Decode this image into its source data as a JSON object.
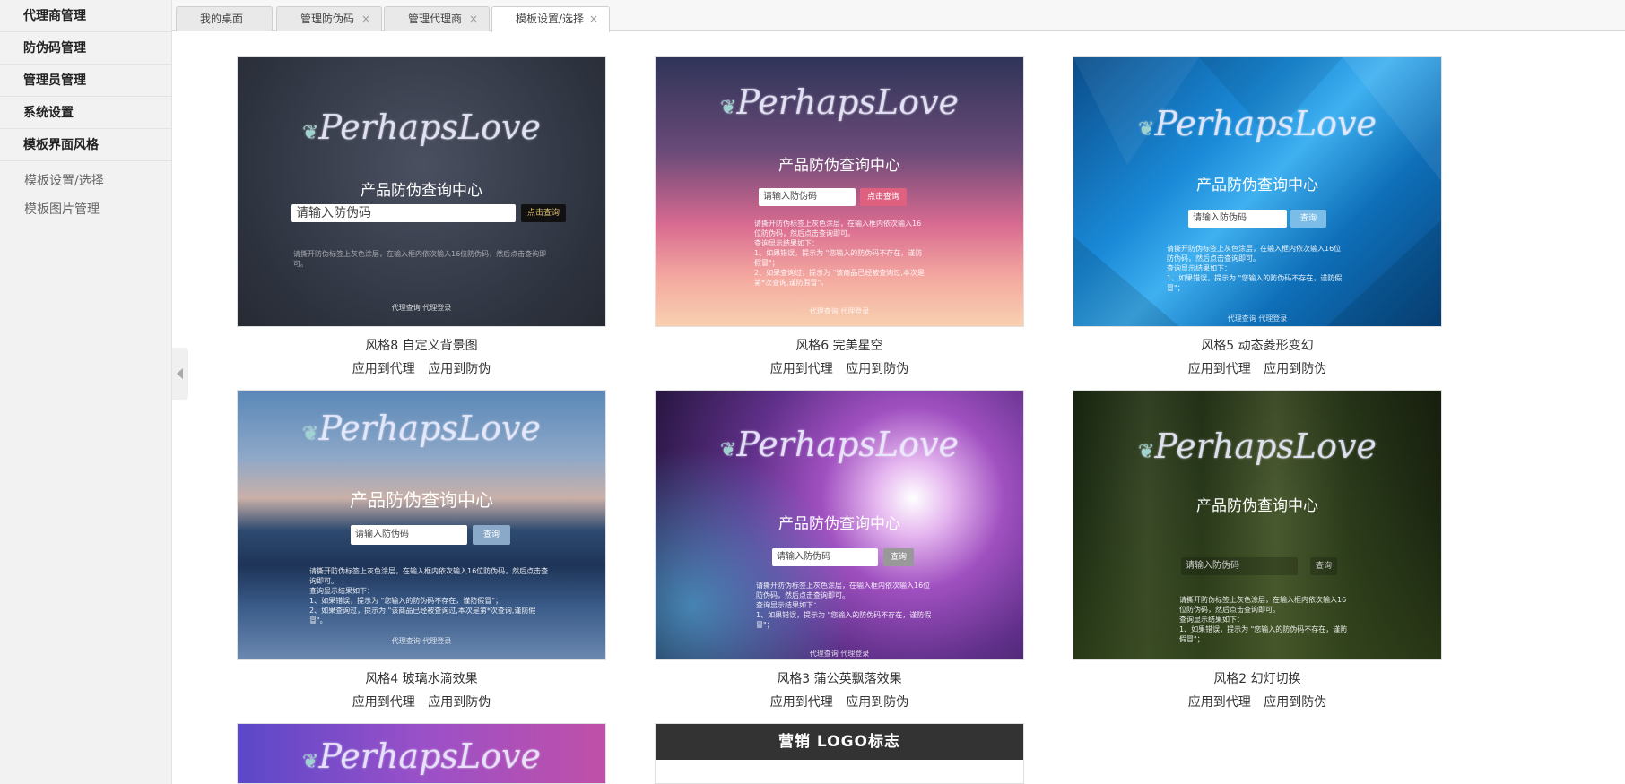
{
  "sidebar": {
    "groups": [
      {
        "label": "代理商管理"
      },
      {
        "label": "防伪码管理"
      },
      {
        "label": "管理员管理"
      },
      {
        "label": "系统设置"
      },
      {
        "label": "模板界面风格"
      }
    ],
    "sub_items": [
      {
        "label": "模板设置/选择"
      },
      {
        "label": "模板图片管理"
      }
    ]
  },
  "tabs": [
    {
      "label": "我的桌面"
    },
    {
      "label": "管理防伪码",
      "close": "×"
    },
    {
      "label": "管理代理商",
      "close": "×"
    },
    {
      "label": "模板设置/选择",
      "close": "×",
      "active": true
    }
  ],
  "preview": {
    "logo": "PerhapsLove",
    "title": "产品防伪查询中心",
    "input_placeholder_1": "请输入防伪码",
    "input_placeholder_2": "请输入防伪码",
    "btn_query": "查询",
    "btn_click_query": "点击查询",
    "desc_1": "请撕开防伪标签上灰色涂层，在输入框内依次输入16位防伪码，然后点击查询即可。",
    "desc_2": "查询显示结果如下：",
    "desc_3": "1、如果错误，提示为 \"您输入的防伪码不存在，谨防假冒\"；",
    "desc_4": "2、如果查询过，提示为 \"该商品已经被查询过,本次是第*次查询,谨防假冒\"。",
    "foot": "代理查询    代理登录"
  },
  "cards": [
    {
      "caption": "风格8 自定义背景图",
      "apply_agent": "应用到代理",
      "apply_anti": "应用到防伪"
    },
    {
      "caption": "风格6 完美星空",
      "apply_agent": "应用到代理",
      "apply_anti": "应用到防伪"
    },
    {
      "caption": "风格5 动态菱形变幻",
      "apply_agent": "应用到代理",
      "apply_anti": "应用到防伪"
    },
    {
      "caption": "风格4 玻璃水滴效果",
      "apply_agent": "应用到代理",
      "apply_anti": "应用到防伪"
    },
    {
      "caption": "风格3 蒲公英飘落效果",
      "apply_agent": "应用到代理",
      "apply_anti": "应用到防伪"
    },
    {
      "caption": "风格2 幻灯切换",
      "apply_agent": "应用到代理",
      "apply_anti": "应用到防伪"
    },
    {
      "caption": "",
      "apply_agent": "",
      "apply_anti": ""
    },
    {
      "caption": "",
      "apply_agent": "",
      "apply_anti": "",
      "banner": "营销 LOGO标志"
    }
  ],
  "colors": {
    "sidebar_bg": "#f2f2f2",
    "tab_active_bg": "#ffffff"
  },
  "icons": {
    "collapse": "chevron-left-icon",
    "tab_close": "close-icon"
  }
}
